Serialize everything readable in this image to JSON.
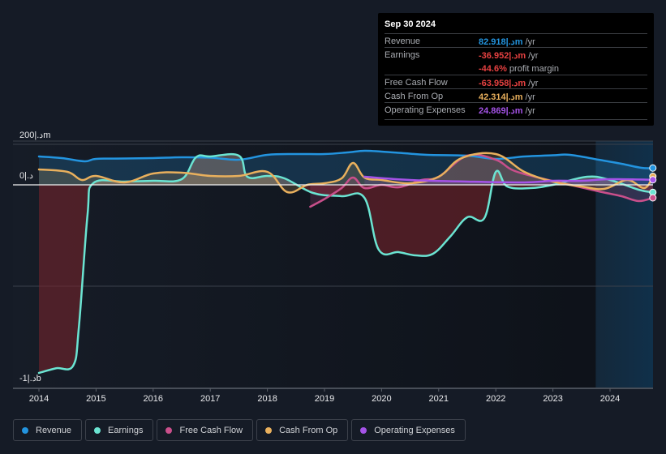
{
  "tooltip": {
    "date": "Sep 30 2024",
    "rows": [
      {
        "label": "Revenue",
        "value": "82.918|.دm",
        "unit": " /yr",
        "color": "#2394df"
      },
      {
        "label": "Earnings",
        "value": "-36.952|.دm",
        "unit": " /yr",
        "color": "#e64141"
      },
      {
        "label": "",
        "value": "-44.6%",
        "unit": " profit margin",
        "color": "#e64141"
      },
      {
        "label": "Free Cash Flow",
        "value": "-63.958|.دm",
        "unit": " /yr",
        "color": "#e64141"
      },
      {
        "label": "Cash From Op",
        "value": "42.314|.دm",
        "unit": " /yr",
        "color": "#e9b05d"
      },
      {
        "label": "Operating Expenses",
        "value": "24.869|.دm",
        "unit": " /yr",
        "color": "#a553e8"
      }
    ]
  },
  "legend": [
    {
      "label": "Revenue",
      "color": "#2394df"
    },
    {
      "label": "Earnings",
      "color": "#6be4d2"
    },
    {
      "label": "Free Cash Flow",
      "color": "#c94f8b"
    },
    {
      "label": "Cash From Op",
      "color": "#e9b05d"
    },
    {
      "label": "Operating Expenses",
      "color": "#a553e8"
    }
  ],
  "chart_data": {
    "type": "line",
    "title": "",
    "xlabel": "",
    "ylabel": "",
    "units": "|.د millions",
    "ylim": [
      -1000,
      200
    ],
    "xlim": [
      2013.55,
      2024.75
    ],
    "y_tick_labels": [
      {
        "value": 200,
        "label": "200|.دm"
      },
      {
        "value": 0,
        "label": "0|.د"
      },
      {
        "value": -1000,
        "label": "-1|.دb"
      }
    ],
    "gridlines": [
      200,
      0,
      -500
    ],
    "x_tick_labels": [
      "2014",
      "2015",
      "2016",
      "2017",
      "2018",
      "2019",
      "2020",
      "2021",
      "2022",
      "2023",
      "2024"
    ],
    "forecast_shade_start": 2023.75,
    "series": [
      {
        "name": "Revenue",
        "color": "#2394df",
        "x": [
          2014.0,
          2014.4,
          2014.8,
          2015.0,
          2015.5,
          2016.0,
          2016.5,
          2017.0,
          2017.5,
          2018.0,
          2018.5,
          2019.0,
          2019.4,
          2019.7,
          2020.0,
          2020.4,
          2020.8,
          2021.5,
          2022.0,
          2022.5,
          2023.0,
          2023.3,
          2023.8,
          2024.2,
          2024.55,
          2024.75
        ],
        "y": [
          140,
          132,
          116,
          128,
          130,
          132,
          136,
          134,
          124,
          148,
          152,
          152,
          160,
          168,
          164,
          156,
          148,
          144,
          128,
          140,
          146,
          148,
          124,
          104,
          84,
          83
        ]
      },
      {
        "name": "Earnings",
        "color": "#6be4d2",
        "x": [
          2014.0,
          2014.3,
          2014.6,
          2014.7,
          2014.85,
          2014.95,
          2015.5,
          2016.0,
          2016.5,
          2016.75,
          2017.0,
          2017.5,
          2017.65,
          2018.0,
          2018.3,
          2018.8,
          2019.3,
          2019.7,
          2019.95,
          2020.3,
          2020.6,
          2020.9,
          2021.2,
          2021.5,
          2021.8,
          2022.0,
          2022.2,
          2022.6,
          2023.0,
          2023.6,
          2024.0,
          2024.5,
          2024.75
        ],
        "y": [
          -928,
          -905,
          -892,
          -700,
          -150,
          8,
          16,
          20,
          28,
          136,
          140,
          144,
          40,
          44,
          32,
          -40,
          -56,
          -64,
          -320,
          -332,
          -348,
          -340,
          -256,
          -160,
          -164,
          64,
          -8,
          -16,
          0,
          40,
          24,
          -24,
          -37
        ]
      },
      {
        "name": "Free Cash Flow",
        "color": "#c94f8b",
        "x": [
          2018.75,
          2019.0,
          2019.3,
          2019.5,
          2019.7,
          2020.0,
          2020.3,
          2020.7,
          2021.0,
          2021.5,
          2022.0,
          2022.3,
          2022.8,
          2023.3,
          2023.8,
          2024.2,
          2024.5,
          2024.75
        ],
        "y": [
          -108,
          -70,
          -16,
          36,
          -16,
          0,
          -12,
          24,
          40,
          144,
          124,
          72,
          32,
          0,
          -32,
          -56,
          -80,
          -64
        ]
      },
      {
        "name": "Cash From Op",
        "color": "#e9b05d",
        "x": [
          2014.0,
          2014.5,
          2014.75,
          2015.0,
          2015.5,
          2016.0,
          2016.5,
          2017.0,
          2017.5,
          2018.0,
          2018.35,
          2018.7,
          2019.0,
          2019.3,
          2019.5,
          2019.7,
          2020.0,
          2020.5,
          2021.0,
          2021.4,
          2022.0,
          2022.5,
          2023.0,
          2023.5,
          2023.9,
          2024.3,
          2024.6,
          2024.75
        ],
        "y": [
          76,
          64,
          24,
          44,
          12,
          56,
          60,
          44,
          44,
          64,
          -36,
          0,
          8,
          32,
          108,
          36,
          24,
          8,
          40,
          132,
          152,
          64,
          16,
          -8,
          -20,
          24,
          -16,
          42
        ]
      },
      {
        "name": "Operating Expenses",
        "color": "#a553e8",
        "x": [
          2019.7,
          2020.5,
          2021.5,
          2022.5,
          2023.0,
          2023.5,
          2024.0,
          2024.75
        ],
        "y": [
          40,
          24,
          16,
          12,
          20,
          20,
          28,
          25
        ]
      }
    ]
  }
}
